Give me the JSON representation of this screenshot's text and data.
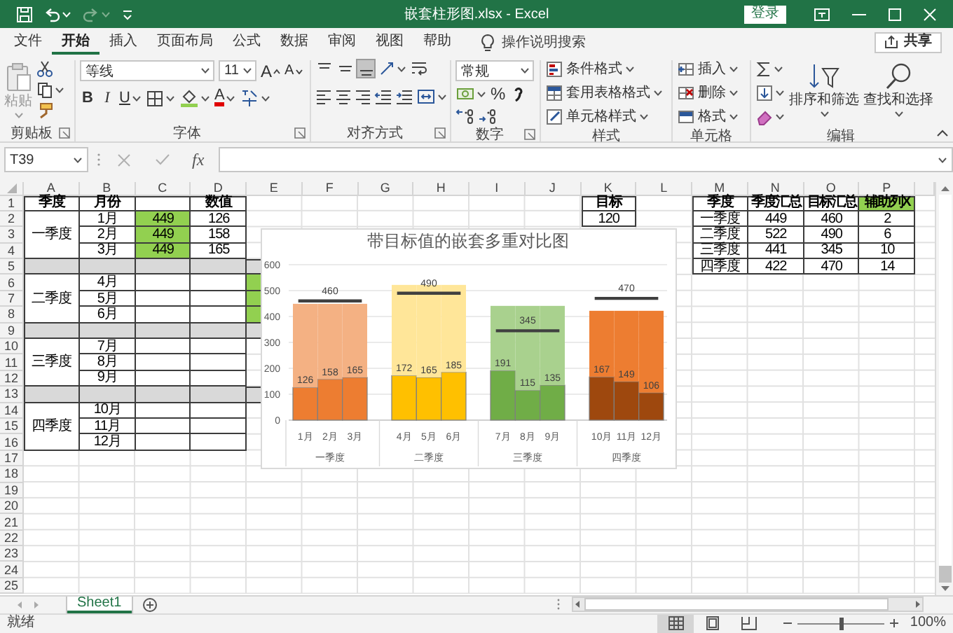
{
  "window": {
    "title": "嵌套柱形图.xlsx - Excel",
    "login_button": "登录"
  },
  "quick_access": {
    "redo": {
      "disabled": true
    }
  },
  "menu": {
    "tabs": [
      {
        "label": "文件",
        "selected": false
      },
      {
        "label": "开始",
        "selected": true
      },
      {
        "label": "插入",
        "selected": false
      },
      {
        "label": "页面布局",
        "selected": false
      },
      {
        "label": "公式",
        "selected": false
      },
      {
        "label": "数据",
        "selected": false
      },
      {
        "label": "审阅",
        "selected": false
      },
      {
        "label": "视图",
        "selected": false
      },
      {
        "label": "帮助",
        "selected": false
      }
    ],
    "search": {
      "placeholder": "操作说明搜索"
    },
    "share_button": "共享"
  },
  "ribbon": {
    "clipboard": {
      "label": "剪贴板",
      "paste": {
        "label": "粘贴",
        "disabled": true
      }
    },
    "font": {
      "label": "字体",
      "font_name": "等线",
      "font_size": "11",
      "grow": "A",
      "shrink": "A",
      "bold": "B",
      "italic": "I",
      "underline": "U",
      "font_color": "A"
    },
    "alignment": {
      "label": "对齐方式",
      "vertical": [
        {
          "selected": false
        },
        {
          "selected": false
        },
        {
          "selected": true
        }
      ]
    },
    "number": {
      "label": "数字",
      "format": "常规",
      "percent": "%"
    },
    "styles": {
      "label": "样式",
      "items": [
        "条件格式",
        "套用表格格式",
        "单元格样式"
      ]
    },
    "cells": {
      "label": "单元格",
      "items": [
        "插入",
        "删除",
        "格式"
      ]
    },
    "editing": {
      "label": "编辑",
      "items": [
        "排序和筛选",
        "查找和选择"
      ]
    }
  },
  "formula_bar": {
    "name_box": "T39",
    "cancel": {
      "disabled": true
    },
    "enter": {
      "disabled": true
    },
    "function": "fx"
  },
  "sheet": {
    "columns": [
      "A",
      "B",
      "C",
      "D",
      "E",
      "F",
      "G",
      "H",
      "I",
      "J",
      "K",
      "L",
      "M",
      "N",
      "O",
      "P"
    ],
    "rows": [
      {
        "header": "1",
        "cells": [
          {
            "kind": "table",
            "text": "季度",
            "bold": true
          },
          {
            "kind": "table",
            "text": "月份",
            "bold": true
          },
          {
            "kind": "table"
          },
          {
            "kind": "table",
            "text": "数值",
            "bold": true
          },
          {
            "kind": "plain"
          },
          {
            "kind": "plain"
          },
          {
            "kind": "plain"
          },
          {
            "kind": "plain"
          },
          {
            "kind": "plain"
          },
          {
            "kind": "plain"
          },
          {
            "kind": "table",
            "text": "目标",
            "bold": true
          },
          {
            "kind": "plain"
          },
          {
            "kind": "table",
            "text": "季度",
            "bold": true
          },
          {
            "kind": "table",
            "text": "季度汇总",
            "bold": true
          },
          {
            "kind": "table",
            "text": "目标汇总",
            "bold": true
          },
          {
            "kind": "table",
            "text": "辅助列X",
            "bold": true,
            "color": "#92d050"
          }
        ]
      },
      {
        "header": "2",
        "cells": [
          {
            "kind": "merged",
            "text": "一季度"
          },
          {
            "kind": "table",
            "text": "1月"
          },
          {
            "kind": "table",
            "text": "449",
            "color": "#92d050"
          },
          {
            "kind": "table",
            "text": "126"
          },
          {
            "kind": "plain"
          },
          {
            "kind": "plain"
          },
          {
            "kind": "plain"
          },
          {
            "kind": "plain"
          },
          {
            "kind": "plain"
          },
          {
            "kind": "plain"
          },
          {
            "kind": "table",
            "text": "120"
          },
          {
            "kind": "plain"
          },
          {
            "kind": "table",
            "text": "一季度"
          },
          {
            "kind": "table",
            "text": "449"
          },
          {
            "kind": "table",
            "text": "460"
          },
          {
            "kind": "table",
            "text": "2"
          }
        ]
      },
      {
        "header": "3",
        "cells": [
          {
            "kind": "covered"
          },
          {
            "kind": "table",
            "text": "2月"
          },
          {
            "kind": "table",
            "text": "449",
            "color": "#92d050"
          },
          {
            "kind": "table",
            "text": "158"
          },
          {
            "kind": "plain"
          },
          {
            "kind": "plain"
          },
          {
            "kind": "plain"
          },
          {
            "kind": "plain"
          },
          {
            "kind": "plain"
          },
          {
            "kind": "plain"
          },
          {
            "kind": "plain"
          },
          {
            "kind": "plain"
          },
          {
            "kind": "table",
            "text": "二季度"
          },
          {
            "kind": "table",
            "text": "522"
          },
          {
            "kind": "table",
            "text": "490"
          },
          {
            "kind": "table",
            "text": "6"
          }
        ]
      },
      {
        "header": "4",
        "cells": [
          {
            "kind": "covered"
          },
          {
            "kind": "table",
            "text": "3月"
          },
          {
            "kind": "table",
            "text": "449",
            "color": "#92d050"
          },
          {
            "kind": "table",
            "text": "165"
          },
          {
            "kind": "plain"
          },
          {
            "kind": "plain"
          },
          {
            "kind": "plain"
          },
          {
            "kind": "plain"
          },
          {
            "kind": "plain"
          },
          {
            "kind": "plain"
          },
          {
            "kind": "plain"
          },
          {
            "kind": "plain"
          },
          {
            "kind": "table",
            "text": "三季度"
          },
          {
            "kind": "table",
            "text": "441"
          },
          {
            "kind": "table",
            "text": "345"
          },
          {
            "kind": "table",
            "text": "10"
          }
        ]
      },
      {
        "header": "5",
        "cells": [
          {
            "kind": "table",
            "color": "#d9d9d9"
          },
          {
            "kind": "table",
            "color": "#d9d9d9"
          },
          {
            "kind": "table",
            "color": "#d9d9d9"
          },
          {
            "kind": "table",
            "color": "#d9d9d9"
          },
          {
            "kind": "table",
            "color": "#d9d9d9"
          },
          {
            "kind": "plain"
          },
          {
            "kind": "plain"
          },
          {
            "kind": "plain"
          },
          {
            "kind": "plain"
          },
          {
            "kind": "plain"
          },
          {
            "kind": "plain"
          },
          {
            "kind": "plain"
          },
          {
            "kind": "table",
            "text": "四季度"
          },
          {
            "kind": "table",
            "text": "422"
          },
          {
            "kind": "table",
            "text": "470"
          },
          {
            "kind": "table",
            "text": "14"
          }
        ]
      },
      {
        "header": "6",
        "cells": [
          {
            "kind": "merged",
            "text": "二季度"
          },
          {
            "kind": "table",
            "text": "4月"
          },
          {
            "kind": "table"
          },
          {
            "kind": "table"
          },
          {
            "kind": "table",
            "color": "#92d050"
          }
        ]
      },
      {
        "header": "7",
        "cells": [
          {
            "kind": "covered"
          },
          {
            "kind": "table",
            "text": "5月"
          },
          {
            "kind": "table"
          },
          {
            "kind": "table"
          },
          {
            "kind": "table",
            "color": "#92d050"
          }
        ]
      },
      {
        "header": "8",
        "cells": [
          {
            "kind": "covered"
          },
          {
            "kind": "table",
            "text": "6月"
          },
          {
            "kind": "table"
          },
          {
            "kind": "table"
          },
          {
            "kind": "table",
            "color": "#92d050"
          }
        ]
      },
      {
        "header": "9",
        "cells": [
          {
            "kind": "table",
            "color": "#d9d9d9"
          },
          {
            "kind": "table",
            "color": "#d9d9d9"
          },
          {
            "kind": "table",
            "color": "#d9d9d9"
          },
          {
            "kind": "table",
            "color": "#d9d9d9"
          },
          {
            "kind": "table",
            "color": "#d9d9d9"
          }
        ]
      },
      {
        "header": "10",
        "cells": [
          {
            "kind": "merged",
            "text": "三季度"
          },
          {
            "kind": "table",
            "text": "7月"
          },
          {
            "kind": "table"
          },
          {
            "kind": "table"
          }
        ]
      },
      {
        "header": "11",
        "cells": [
          {
            "kind": "covered"
          },
          {
            "kind": "table",
            "text": "8月"
          },
          {
            "kind": "table"
          },
          {
            "kind": "table"
          }
        ]
      },
      {
        "header": "12",
        "cells": [
          {
            "kind": "covered"
          },
          {
            "kind": "table",
            "text": "9月"
          },
          {
            "kind": "table"
          },
          {
            "kind": "table"
          }
        ]
      },
      {
        "header": "13",
        "cells": [
          {
            "kind": "table",
            "color": "#d9d9d9"
          },
          {
            "kind": "table",
            "color": "#d9d9d9"
          },
          {
            "kind": "table",
            "color": "#d9d9d9"
          },
          {
            "kind": "table",
            "color": "#d9d9d9"
          },
          {
            "kind": "table",
            "color": "#d9d9d9"
          }
        ]
      },
      {
        "header": "14",
        "cells": [
          {
            "kind": "merged",
            "text": "四季度"
          },
          {
            "kind": "table",
            "text": "10月"
          },
          {
            "kind": "table"
          },
          {
            "kind": "table"
          }
        ]
      },
      {
        "header": "15",
        "cells": [
          {
            "kind": "covered"
          },
          {
            "kind": "table",
            "text": "11月"
          },
          {
            "kind": "table"
          },
          {
            "kind": "table"
          }
        ]
      },
      {
        "header": "16",
        "cells": [
          {
            "kind": "covered"
          },
          {
            "kind": "table",
            "text": "12月"
          },
          {
            "kind": "table"
          },
          {
            "kind": "table"
          }
        ]
      },
      {
        "header": "17"
      },
      {
        "header": "18"
      },
      {
        "header": "19"
      },
      {
        "header": "20"
      },
      {
        "header": "21"
      },
      {
        "header": "22"
      },
      {
        "header": "23"
      },
      {
        "header": "24"
      },
      {
        "header": "25"
      }
    ]
  },
  "chart": {
    "chart_data": {
      "type": "bar",
      "title": "带目标值的嵌套多重对比图",
      "categories": [
        "1月",
        "2月",
        "3月",
        "4月",
        "5月",
        "6月",
        "7月",
        "8月",
        "9月",
        "10月",
        "11月",
        "12月"
      ],
      "series": [
        {
          "type": "bar",
          "color": "#ed7d31",
          "values": [
            126,
            158,
            165,
            null,
            null,
            null,
            null,
            null,
            null,
            null,
            null,
            null
          ]
        },
        {
          "type": "bar",
          "color": "#ffc000",
          "values": [
            null,
            null,
            null,
            172,
            165,
            185,
            null,
            null,
            null,
            null,
            null,
            null
          ]
        },
        {
          "type": "bar",
          "color": "#70ad47",
          "values": [
            null,
            null,
            null,
            null,
            null,
            null,
            191,
            115,
            135,
            null,
            null,
            null
          ]
        },
        {
          "type": "bar",
          "color": "#9e480e",
          "values": [
            null,
            null,
            null,
            null,
            null,
            null,
            null,
            null,
            null,
            167,
            149,
            106
          ]
        },
        {
          "type": "bar",
          "color": "#f4b183",
          "data_labels": false,
          "values": [
            323,
            291,
            284,
            null,
            null,
            null,
            null,
            null,
            null,
            null,
            null,
            null
          ]
        },
        {
          "type": "bar",
          "color": "#ffe699",
          "data_labels": false,
          "values": [
            null,
            null,
            null,
            350,
            357,
            337,
            null,
            null,
            null,
            null,
            null,
            null
          ]
        },
        {
          "type": "bar",
          "color": "#a9d18e",
          "data_labels": false,
          "values": [
            null,
            null,
            null,
            null,
            null,
            null,
            250,
            326,
            306,
            null,
            null,
            null
          ]
        },
        {
          "type": "bar",
          "color": "#ed7d31",
          "data_labels": false,
          "values": [
            null,
            null,
            null,
            null,
            null,
            null,
            null,
            null,
            null,
            255,
            273,
            316
          ]
        },
        {
          "type": "line",
          "color": "#404040",
          "data_labels": false,
          "values": [
            460,
            460,
            460,
            null,
            null,
            null,
            null,
            null,
            null,
            null,
            null,
            null
          ]
        },
        {
          "type": "line",
          "color": "#404040",
          "data_labels": false,
          "values": [
            null,
            null,
            null,
            490,
            490,
            490,
            null,
            null,
            null,
            null,
            null,
            null
          ]
        },
        {
          "type": "line",
          "color": "#404040",
          "data_labels": false,
          "values": [
            null,
            null,
            null,
            null,
            null,
            null,
            345,
            345,
            345,
            null,
            null,
            null
          ]
        },
        {
          "type": "line",
          "color": "#404040",
          "data_labels": false,
          "values": [
            null,
            null,
            null,
            null,
            null,
            null,
            null,
            null,
            null,
            470,
            470,
            470
          ]
        }
      ],
      "ylim": [
        0,
        600
      ],
      "yticks": [
        0,
        100,
        200,
        300,
        400,
        500,
        600
      ],
      "grid": true,
      "stacked": true,
      "data_labels": true,
      "annotations": [
        {
          "text": "460",
          "x": "2月",
          "y": 460
        },
        {
          "text": "490",
          "x": "5月",
          "y": 490
        },
        {
          "text": "345",
          "x": "8月",
          "y": 345
        },
        {
          "text": "470",
          "x": "11月",
          "y": 470
        },
        "一季度",
        "二季度",
        "三季度",
        "四季度"
      ]
    }
  },
  "sheet_tabs": [
    {
      "label": "Sheet1",
      "selected": true
    }
  ],
  "status_bar": {
    "status": "就绪",
    "views": [
      {
        "selected": true
      },
      {
        "selected": false
      },
      {
        "selected": false
      }
    ],
    "zoom": {
      "level": 0.5,
      "reading": "100%"
    }
  }
}
